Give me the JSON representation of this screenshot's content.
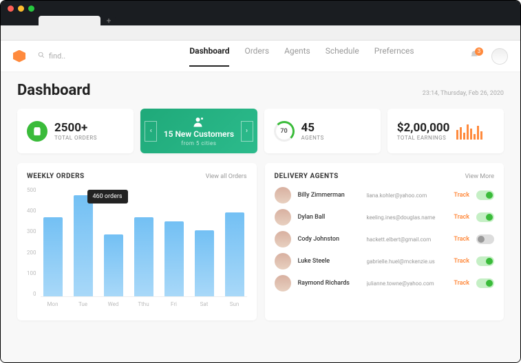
{
  "nav": {
    "search_placeholder": "find..",
    "items": [
      "Dashboard",
      "Orders",
      "Agents",
      "Schedule",
      "Prefernces"
    ],
    "active": "Dashboard",
    "badge": "3"
  },
  "header": {
    "title": "Dashboard",
    "timestamp": "23:14, Thursday, Feb 26, 2020"
  },
  "cards": {
    "orders": {
      "value": "2500+",
      "label": "TOTAL ORDERS"
    },
    "customers": {
      "value": "15 New Customers",
      "label": "from 5 cities"
    },
    "agents": {
      "ring": "70",
      "value": "45",
      "label": "AGENTS"
    },
    "earnings": {
      "value": "$2,00,000",
      "label": "TOTAL EARNINGS"
    }
  },
  "weekly": {
    "title": "WEEKLY ORDERS",
    "link": "View all Orders",
    "tooltip": "460 orders"
  },
  "delivery": {
    "title": "DELIVERY AGENTS",
    "link": "View More",
    "track": "Track",
    "agents": [
      {
        "name": "Billy Zimmerman",
        "email": "liana.kohler@yahoo.com",
        "on": true
      },
      {
        "name": "Dylan Ball",
        "email": "keeling.ines@douglas.name",
        "on": true
      },
      {
        "name": "Cody Johnston",
        "email": "hackett.elbert@gmail.com",
        "on": false
      },
      {
        "name": "Luke Steele",
        "email": "gabrielle.huel@mckenzie.us",
        "on": true
      },
      {
        "name": "Raymond Richards",
        "email": "julianne.towne@yahoo.com",
        "on": true
      }
    ]
  },
  "chart_data": {
    "type": "bar",
    "title": "WEEKLY ORDERS",
    "ylabel": "",
    "xlabel": "",
    "ylim": [
      0,
      500
    ],
    "yticks": [
      0,
      100,
      200,
      300,
      400,
      500
    ],
    "categories": [
      "Mon",
      "Tue",
      "Wed",
      "Tthu",
      "Fri",
      "Sat",
      "Sun"
    ],
    "values": [
      360,
      460,
      280,
      360,
      340,
      300,
      380
    ],
    "highlight": {
      "index": 1,
      "label": "460 orders"
    }
  },
  "spark_values": [
    14,
    18,
    10,
    22,
    16,
    8,
    20,
    12
  ]
}
